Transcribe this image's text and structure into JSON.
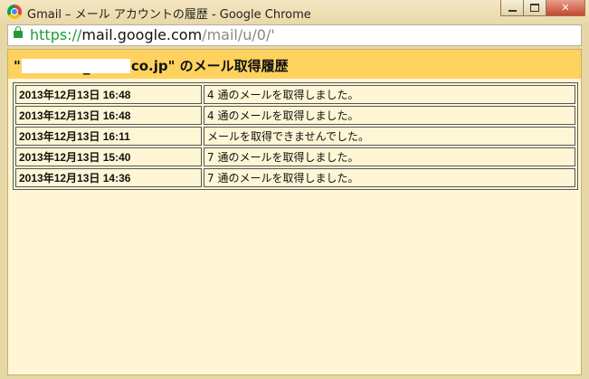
{
  "window": {
    "title": "Gmail – メール アカウントの履歴 - Google Chrome"
  },
  "address_bar": {
    "scheme": "https://",
    "host": "mail.google.com",
    "path": "/mail/u/0/'"
  },
  "page": {
    "title_prefix": "\"",
    "title_suffix": "co.jp\" のメール取得履歴",
    "header_color": "#ffd260",
    "background_color": "#fff6d6"
  },
  "history": {
    "rows": [
      {
        "date": "2013年12月13日  16:48",
        "message": "4 通のメールを取得しました。"
      },
      {
        "date": "2013年12月13日  16:48",
        "message": "4 通のメールを取得しました。"
      },
      {
        "date": "2013年12月13日  16:11",
        "message": "メールを取得できませんでした。"
      },
      {
        "date": "2013年12月13日  15:40",
        "message": "7 通のメールを取得しました。"
      },
      {
        "date": "2013年12月13日  14:36",
        "message": "7 通のメールを取得しました。"
      }
    ]
  }
}
